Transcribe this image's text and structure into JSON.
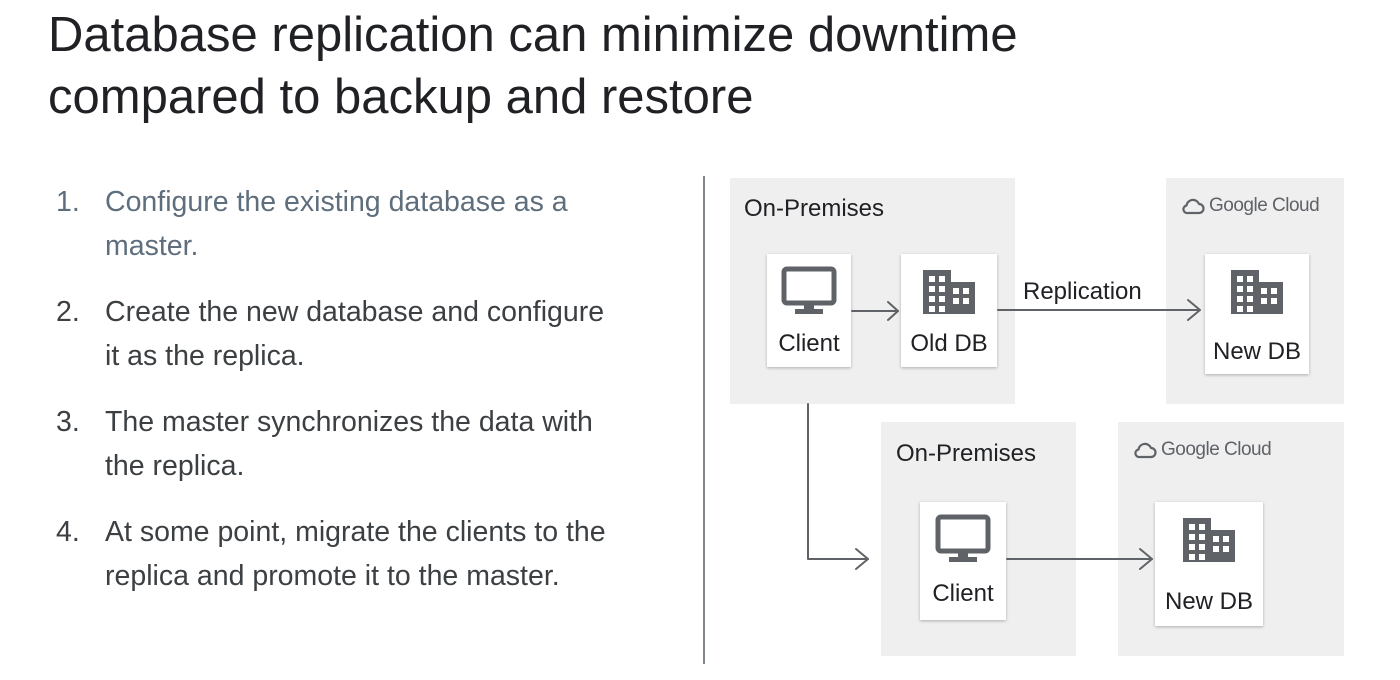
{
  "title": {
    "line1": "Database replication can minimize downtime",
    "line2": "compared to backup and restore"
  },
  "steps": [
    {
      "number": "1.",
      "line1": "Configure the existing database as a",
      "line2": "master."
    },
    {
      "number": "2.",
      "line1": "Create the new database and configure",
      "line2": "it as the replica."
    },
    {
      "number": "3.",
      "line1": "The master synchronizes the data with",
      "line2": "the replica."
    },
    {
      "number": "4.",
      "line1": "At some point, migrate the clients to the",
      "line2": "replica and promote it to the master."
    }
  ],
  "diagram": {
    "before": {
      "on_prem_label": "On-Premises",
      "cloud_label": "Google Cloud",
      "client_label": "Client",
      "old_db_label": "Old DB",
      "new_db_label": "New DB",
      "replication_label": "Replication"
    },
    "after": {
      "on_prem_label": "On-Premises",
      "cloud_label": "Google Cloud",
      "client_label": "Client",
      "new_db_label": "New DB"
    }
  },
  "colors": {
    "panel_bg": "#efefef",
    "text": "#202124",
    "step_text": "#3c4043",
    "step_highlight": "#5f6e7d",
    "icon": "#5f6368",
    "connector": "#5f6368"
  },
  "icons": {
    "client": "monitor-icon",
    "database": "building-icon",
    "cloud": "google-cloud-logo-icon"
  }
}
